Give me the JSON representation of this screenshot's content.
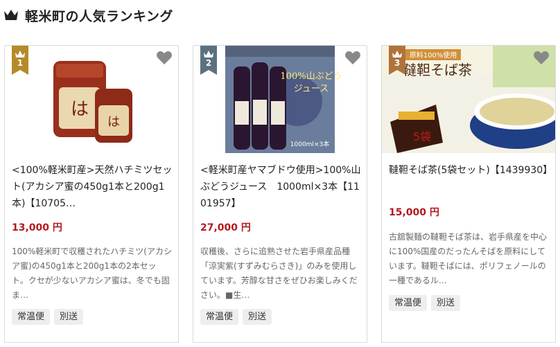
{
  "header": {
    "title": "軽米町の人気ランキング",
    "crown_icon": "crown-icon"
  },
  "colors": {
    "rank1": "#b58a2a",
    "rank2": "#5c7180",
    "rank3": "#b0733a",
    "price": "#b3191e",
    "fav": "#888888"
  },
  "cards": [
    {
      "rank": "1",
      "image_overlay_text": "",
      "name": "<100%軽米町産>天然ハチミツセット(アカシア蜜の450g1本と200g1本)【10705…",
      "price": "13,000 円",
      "description": "100%軽米町で収穫されたハチミツ(アカシア蜜)の450g1本と200g1本の2本セット。クセが少ないアカシア蜜は、冬でも固ま…",
      "tags": [
        "常温便",
        "別送"
      ]
    },
    {
      "rank": "2",
      "image_overlay_text": "100%山ぶどうジュース",
      "name": "<軽米町産ヤマブドウ使用>100%山ぶどうジュース　1000ml×3本【1101957】",
      "price": "27,000 円",
      "description": "収穫後、さらに追熟させた岩手県産品種「涼実紫(すずみむらさき)」のみを使用しています。芳醇な甘さをぜひお楽しみください。■生…",
      "tags": [
        "常温便",
        "別送"
      ]
    },
    {
      "rank": "3",
      "image_overlay_text": "韃靼そば茶",
      "name": "韃靼そば茶(5袋セット)【1439930】",
      "price": "15,000 円",
      "description": "古舘製麺の韃靼そば茶は、岩手県産を中心に100%国産のだったんそばを原料にしています。韃靼そばには、ポリフェノールの一種であるル…",
      "tags": [
        "常温便",
        "別送"
      ]
    }
  ]
}
